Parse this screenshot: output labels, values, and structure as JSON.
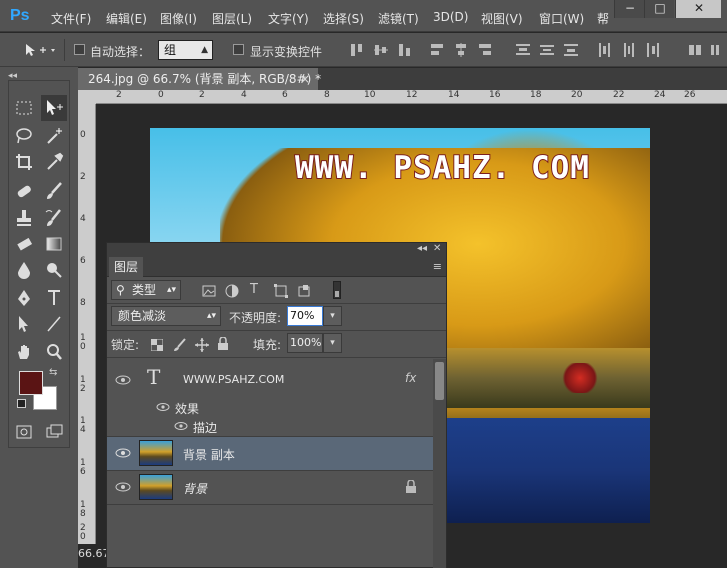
{
  "app": {
    "logo": "Ps"
  },
  "menu": [
    "文件(F)",
    "编辑(E)",
    "图像(I)",
    "图层(L)",
    "文字(Y)",
    "选择(S)",
    "滤镜(T)",
    "3D(D)",
    "视图(V)",
    "窗口(W)",
    "帮"
  ],
  "window_controls": {
    "minimize": "−",
    "maximize": "□",
    "close": "✕"
  },
  "options": {
    "auto_select_label": "自动选择：",
    "auto_select_value": "组",
    "show_transform_label": "显示变换控件"
  },
  "document": {
    "tab_title": "264.jpg @ 66.7% (背景 副本, RGB/8#) *",
    "tab_close": "×",
    "zoom_status": "66.67",
    "watermark": "WWW. PSAHZ. COM"
  },
  "ruler": {
    "h_ticks": [
      "2",
      "0",
      "2",
      "4",
      "6",
      "8",
      "10",
      "12",
      "14",
      "16",
      "18",
      "20",
      "22",
      "24",
      "26"
    ],
    "v_ticks": [
      "0",
      "2",
      "4",
      "6",
      "8",
      "1\n0",
      "1\n2",
      "1\n4",
      "1\n6",
      "1\n8",
      "2\n0",
      "2\n2"
    ]
  },
  "layers_panel": {
    "collapse": "◂◂",
    "close": "✕",
    "tab": "图层",
    "menu": "≡",
    "filter_value": "类型",
    "blend_mode": "颜色减淡",
    "opacity_label": "不透明度:",
    "opacity_value": "70%",
    "lock_label": "锁定:",
    "fill_label": "填充:",
    "fill_value": "100%",
    "layers": [
      {
        "name": "WWW.PSAHZ.COM",
        "type": "text",
        "fx": "fx"
      },
      {
        "name": "效果",
        "type": "effects"
      },
      {
        "name": "描边",
        "type": "effect"
      },
      {
        "name": "背景 副本",
        "type": "image",
        "selected": true
      },
      {
        "name": "背景",
        "type": "image",
        "locked": true
      }
    ]
  },
  "colors": {
    "foreground": "#5a1414",
    "background": "#ffffff",
    "selected_layer": "#5a6878"
  }
}
